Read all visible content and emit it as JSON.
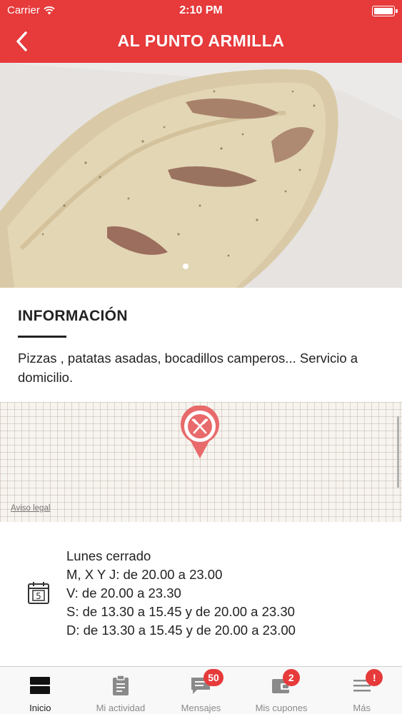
{
  "status_bar": {
    "carrier": "Carrier",
    "time": "2:10 PM"
  },
  "nav": {
    "title": "AL PUNTO ARMILLA"
  },
  "info": {
    "heading": "INFORMACIÓN",
    "description": "Pizzas , patatas asadas, bocadillos camperos... Servicio a domicilio."
  },
  "map": {
    "legal_link": "Aviso legal"
  },
  "hours": {
    "lines": [
      "Lunes cerrado",
      "M, X Y J: de 20.00 a 23.00",
      "V: de 20.00 a 23.30",
      "S: de 13.30 a 15.45 y de 20.00 a 23.30",
      "D: de 13.30 a 15.45 y de 20.00 a 23.00"
    ]
  },
  "tabbar": {
    "tabs": [
      {
        "label": "Inicio",
        "icon": "home-icon"
      },
      {
        "label": "Mi actividad",
        "icon": "clipboard-icon"
      },
      {
        "label": "Mensajes",
        "icon": "chat-icon",
        "badge": "50"
      },
      {
        "label": "Mis cupones",
        "icon": "wallet-icon",
        "badge": "2"
      },
      {
        "label": "Más",
        "icon": "menu-icon",
        "badge": "!"
      }
    ]
  },
  "colors": {
    "brand_red": "#e63a3b",
    "tab_active": "#222222",
    "tab_inactive": "#8a8a8a"
  }
}
